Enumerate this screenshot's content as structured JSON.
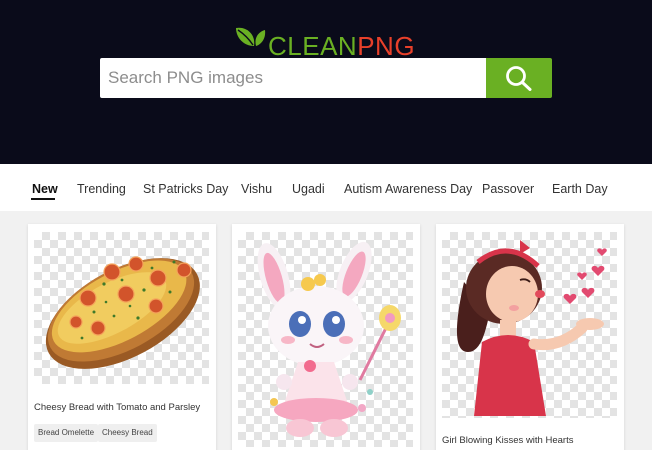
{
  "header": {
    "logo_clean": "CLEAN",
    "logo_png": "PNG",
    "logo_leaf_icon": "leaf-icon",
    "search_placeholder": "Search PNG images",
    "search_icon": "search-icon"
  },
  "colors": {
    "header_bg": "#0a0b1a",
    "brand_green": "#6ab023",
    "brand_red": "#e8402a"
  },
  "nav": {
    "items": [
      {
        "label": "New",
        "active": true
      },
      {
        "label": "Trending"
      },
      {
        "label": "St Patricks Day"
      },
      {
        "label": "Vishu"
      },
      {
        "label": "Ugadi"
      },
      {
        "label": "Autism Awareness Day"
      },
      {
        "label": "Passover"
      },
      {
        "label": "Earth Day"
      }
    ]
  },
  "cards": [
    {
      "title": "Cheesy Bread with Tomato and Parsley",
      "tags": [
        "Bread Omelette",
        "Cheesy Bread"
      ]
    },
    {
      "title": "",
      "tags": []
    },
    {
      "title": "Girl Blowing Kisses with Hearts",
      "tags": []
    }
  ]
}
